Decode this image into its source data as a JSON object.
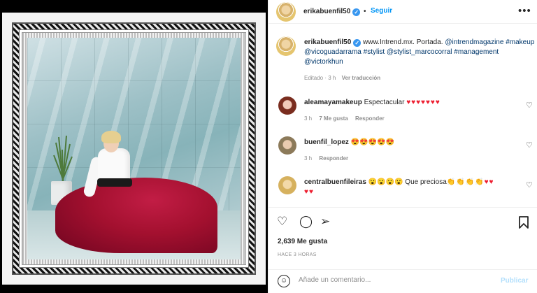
{
  "post": {
    "username": "erikabuenfil50",
    "follow_label": "Seguir",
    "dot": "•",
    "caption_parts": [
      {
        "text": "www.Intrend.mx. Portada. ",
        "link": false
      },
      {
        "text": "@intrendmagazine",
        "link": true
      },
      {
        "text": "#makeup",
        "link": true
      },
      {
        "text": "@vicoguadarrama",
        "link": true
      },
      {
        "text": "#stylist",
        "link": true
      },
      {
        "text": "@stylist_marcocorral",
        "link": true
      },
      {
        "text": "#management",
        "link": true
      },
      {
        "text": "@victorkhun",
        "link": true
      }
    ],
    "edited": "Editado · 3 h",
    "see_translation": "Ver traducción"
  },
  "comments": [
    {
      "user": "aleamayamakeup",
      "text": "Espectacular ",
      "emoji": "♥♥♥♥♥♥♥",
      "time": "3 h",
      "likes": "7 Me gusta",
      "reply": "Responder"
    },
    {
      "user": "buenfil_lopez",
      "text": "",
      "emoji": "😍😍😍😍😍",
      "time": "3 h",
      "likes": "",
      "reply": "Responder"
    },
    {
      "user": "centralbuenfileiras",
      "text": " Que preciosa",
      "emoji_pre": "😮😮😮😮",
      "emoji": "👏👏👏👏♥♥",
      "emoji2": "♥♥"
    }
  ],
  "actions": {
    "like_icon": "heart-outline-icon",
    "comment_icon": "comment-bubble-icon",
    "share_icon": "paper-plane-icon",
    "save_icon": "bookmark-icon"
  },
  "likes": "2,639 Me gusta",
  "time_ago": "HACE 3 HORAS",
  "composer": {
    "placeholder": "Añade un comentario...",
    "publish_label": "Publicar"
  },
  "colors": {
    "link": "#00376b",
    "follow": "#0095f6",
    "verified": "#3897f0",
    "heart": "#ed1c2e",
    "publish_disabled": "#b2dffc"
  }
}
